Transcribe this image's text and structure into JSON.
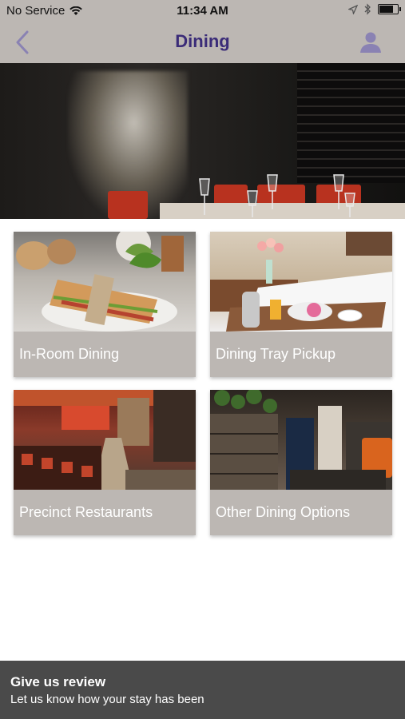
{
  "status_bar": {
    "carrier": "No Service",
    "time": "11:34 AM",
    "battery_level": 0.85
  },
  "nav": {
    "title": "Dining",
    "back_icon": "chevron-left-icon",
    "profile_icon": "person-icon"
  },
  "colors": {
    "bar_background": "#bcb7b3",
    "title": "#3b2c78",
    "card_label_background": "#bcb7b3",
    "review_background": "#4a4a4a"
  },
  "cards": [
    {
      "label": "In-Room Dining"
    },
    {
      "label": "Dining Tray Pickup"
    },
    {
      "label": "Precinct Restaurants"
    },
    {
      "label": "Other Dining Options"
    }
  ],
  "review": {
    "title": "Give us review",
    "subtitle": "Let us know how your stay has been"
  }
}
